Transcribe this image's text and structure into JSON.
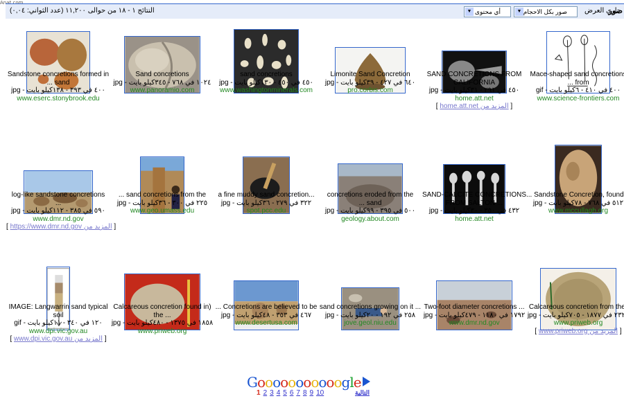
{
  "watermark": "Anat.com",
  "topbar": {
    "brand": "صور",
    "showing_label": "جاري العرض",
    "size_select": "صور بكل الاحجام",
    "content_select": "أي محتوى",
    "results_text": "النتائج ١ - ١٨ من حوالى ١١,٢٠٠ (عدد الثواني: ٠,٠٤)"
  },
  "results": [
    {
      "title": "Sandstone concretions formed in",
      "title2": "... sand",
      "meta": "٤٠٠ في ٣٩٣ - ١٣٨كيلو بايت - jpg",
      "url": "www.eserc.stonybrook.edu",
      "more": "",
      "img": "sandstone"
    },
    {
      "title": "Sand concretions",
      "title2": "",
      "meta": "١٠٢٤ في ٧٦٨ - ٣٤٥كيلو بايت - jpg",
      "url": "www.panoramio.com",
      "more": "",
      "img": "sandconc"
    },
    {
      "title": "sand concretions",
      "title2": "",
      "meta": "٤٥٠ في ٤٥٠ - ١٣٠كيلو بايت - jpg",
      "url": "www.washingtonminerals.com",
      "more": "",
      "img": "minerals"
    },
    {
      "title": "Limonite Sand Concretion",
      "title2": "",
      "meta": "٦٤٠ في ٤٢٧ - ٣٩كيلو بايت - jpg",
      "url": "pro.corbis.com",
      "more": "",
      "img": "limonite"
    },
    {
      "title": "SAND CONCRETIONS FROM",
      "title2": "CALIFORNIA",
      "meta": "٤٥٠ في ٢٩١ - ٣١كيلو بايت - jpg",
      "url": "home.att.net",
      "more": "home.att.net المزيد من",
      "img": "california"
    },
    {
      "title": "Mace-shaped sand concretions",
      "title2": "... from",
      "meta": "٤٠٠ في ٤١٠ - ٦كيلو بايت - gif",
      "url": "www.science-frontiers.com",
      "more": "",
      "img": "mace"
    },
    {
      "title": "log-like sandstone concretions",
      "title2": "...",
      "meta": "٥٩٠ في ٣٨٥ - ١١٢كيلو بايت - jpg",
      "url": "www.dmr.nd.gov",
      "more": "https://www.dmr.nd.gov المزيد من",
      "img": "loglike"
    },
    {
      "title": "... sand concretions from the",
      "title2": "",
      "meta": "٢٢٥ في ٣٠٠ - ٣٦كيلو بايت - jpg",
      "url": "www.geo.umass.edu",
      "more": "",
      "img": "umass"
    },
    {
      "title": "a fine muddy sand concretion...",
      "title2": "",
      "meta": "٣٢٢ في ٢٧٩ - ٣٦كيلو بايت - jpg",
      "url": "spot.pcc.edu",
      "more": "",
      "img": "muddy"
    },
    {
      "title": "concretions eroded from the",
      "title2": "... sand",
      "meta": "٥٠٠ في ٣٩٥ - ٩٩كيلو بايت - jpg",
      "url": "geology.about.com",
      "more": "",
      "img": "eroded"
    },
    {
      "title": "SAND-CALCITE CONCRETIONS",
      "title2": "FROM SALTON ...",
      "meta": "٤٣٢ في ٣٥٠ - ٣٠كيلو بايت - jpg",
      "url": "home.att.net",
      "more": "",
      "img": "salton"
    },
    {
      "title": "... Sandstone Concretion, found in",
      "title2": "",
      "meta": "٥١٢ في ٧٦٨ - ٧٨كيلو بايت - jpg",
      "url": "www.mccullagh.org",
      "more": "",
      "img": "mccullagh"
    },
    {
      "title": "IMAGE: Langwarrin sand typical",
      "title2": "soil",
      "meta": "١٢٠ في ٣٤٠ - ١١كيلو بايت - gif",
      "url": "www.dpi.vic.gov.au",
      "more": "www.dpi.vic.gov.au المزيد من",
      "img": "soil"
    },
    {
      "title": "Calcareous concretion found in)",
      "title2": "the ...",
      "meta": "١٨٥٨ في ١٣٧٥ - ٤٨٠كيلو بايت - jpg",
      "url": "www.priweb.org",
      "more": "",
      "img": "calc1"
    },
    {
      "title": "... Concretions are believed to be",
      "title2": "",
      "meta": "٤٦٧ في ٣٥٣ - ٤٨كيلو بايت - jpg",
      "url": "www.desertusa.com",
      "more": "",
      "img": "desert"
    },
    {
      "title": "sand concretions growing on it ...",
      "title2": "",
      "meta": "٢٥٨ في ١٩٢ - ٢٠كيلو بايت - jpg",
      "url": "jove.geol.niu.edu",
      "more": "",
      "img": "growing"
    },
    {
      "title": "Two-foot diameter concretions ...",
      "title2": "",
      "meta": "١٧٩٢ في ١١٨٠ - ٤٧٩كيلو بايت - jpg",
      "url": "www.dmr.nd.gov",
      "more": "",
      "img": "twofoot"
    },
    {
      "title": "Calcareous concretion from the)",
      "title2": "",
      "meta": "٢٣٢٩ في ١٨٧٧ - ٧٠٥كيلو بايت - jpg",
      "url": "www.priweb.org",
      "more": "www.priweb.org المزيد من",
      "img": "calc2"
    }
  ],
  "pager": {
    "logo": "Gooooooooooogle",
    "pages": [
      "1",
      "2",
      "3",
      "4",
      "5",
      "6",
      "7",
      "8",
      "9",
      "10"
    ],
    "current": "1",
    "next": "التالية"
  }
}
